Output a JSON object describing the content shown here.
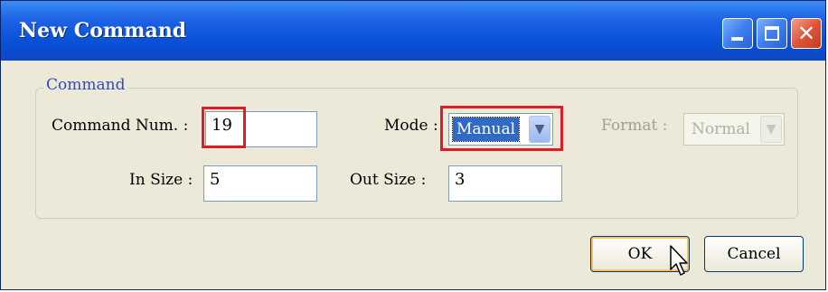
{
  "window": {
    "title": "New Command",
    "controls": {
      "minimize": "minimize-icon",
      "maximize": "maximize-icon",
      "close": "close-icon"
    }
  },
  "group": {
    "legend": "Command",
    "command_num": {
      "label": "Command Num. :",
      "value": "19"
    },
    "mode": {
      "label": "Mode :",
      "value": "Manual"
    },
    "format": {
      "label": "Format :",
      "value": "Normal"
    },
    "in_size": {
      "label": "In Size :",
      "value": "5"
    },
    "out_size": {
      "label": "Out Size :",
      "value": "3"
    }
  },
  "buttons": {
    "ok": "OK",
    "cancel": "Cancel"
  },
  "colors": {
    "title_bar": "#0a52d8",
    "highlight_box": "#e01b24",
    "selection": "#316ac5",
    "legend_text": "#2f49c9"
  }
}
